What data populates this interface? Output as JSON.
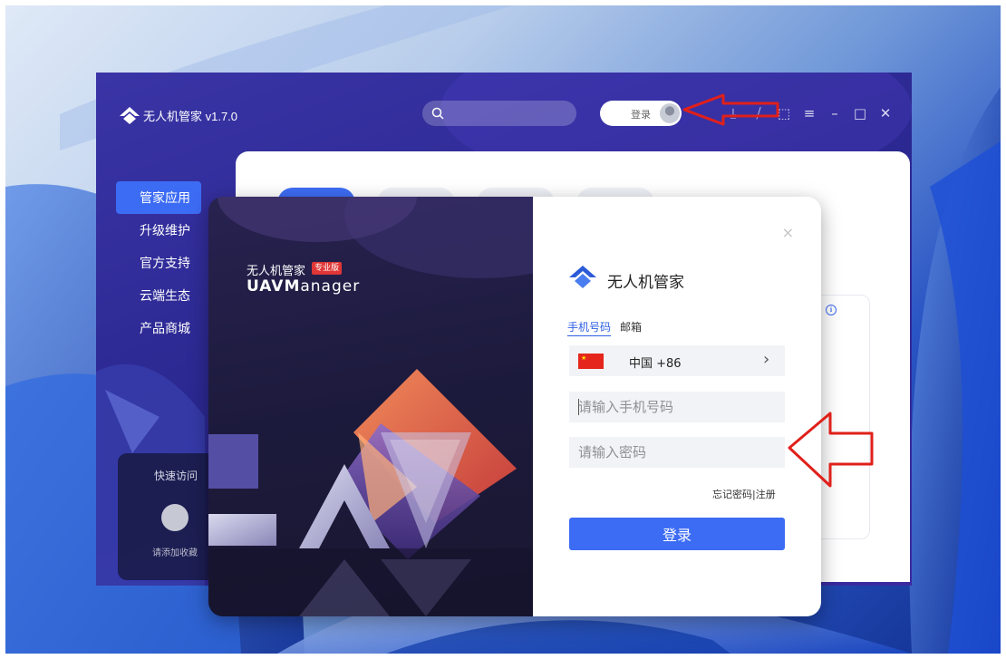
{
  "app": {
    "title": "无人机管家 v1.7.0",
    "search_placeholder": "",
    "login_label": "登录",
    "window_controls": [
      "download-icon",
      "rss-icon",
      "share-icon",
      "menu-icon",
      "minimize-icon",
      "maximize-icon",
      "close-icon"
    ]
  },
  "sidebar": {
    "items": [
      {
        "label": "管家应用",
        "active": true
      },
      {
        "label": "升级维护"
      },
      {
        "label": "官方支持"
      },
      {
        "label": "云端生态"
      },
      {
        "label": "产品商城"
      }
    ]
  },
  "quick_access": {
    "title": "快速访问",
    "hint": "请添加收藏"
  },
  "dialog": {
    "brand_cn": "无人机管家",
    "pro_badge": "专业版",
    "brand_en_bold": "UAVM",
    "brand_en_rest": "anager",
    "close": "×",
    "logo_text": "无人机管家",
    "tabs": [
      {
        "label": "手机号码",
        "active": true
      },
      {
        "label": "邮箱"
      }
    ],
    "country": "中国  +86",
    "phone_placeholder": "请输入手机号码",
    "password_placeholder": "请输入密码",
    "forgot_label": "忘记密码",
    "separator": "|",
    "register_label": "注册",
    "submit_label": "登录"
  },
  "colors": {
    "accent": "#3d6cf4",
    "annotation": "#e0201a",
    "flag": "#e5261d"
  }
}
